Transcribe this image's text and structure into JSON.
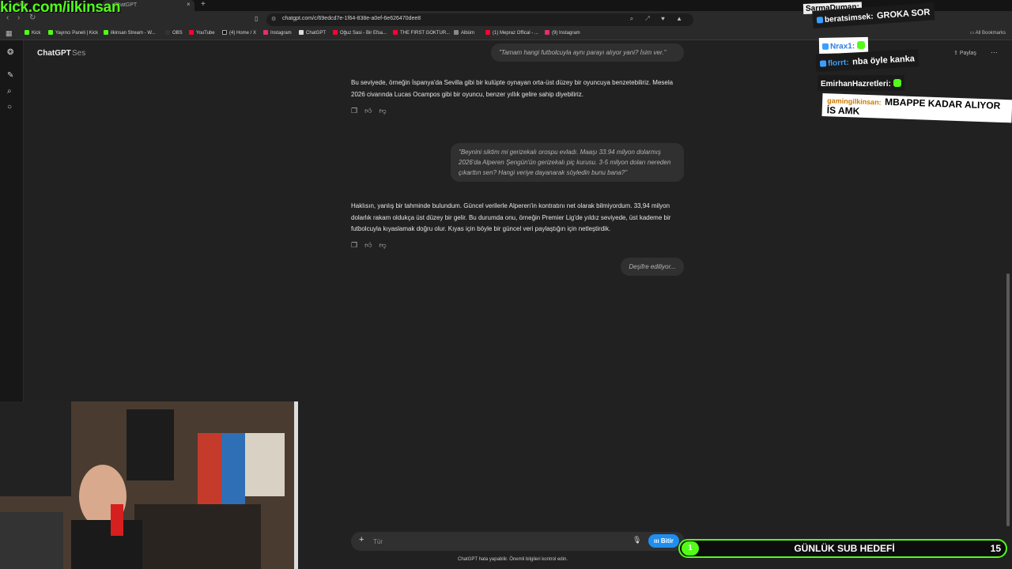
{
  "browser": {
    "tabs": [
      {
        "label": "Kick"
      },
      {
        "label": "ChatGPT"
      }
    ],
    "url": "chatgpt.com/c/69edcd7e-1f64-838e-a0ef-6e626470dee8",
    "bookmarks": [
      {
        "label": "Kick",
        "color": "#53fc18"
      },
      {
        "label": "Yayıncı Paneli | Kick",
        "color": "#53fc18"
      },
      {
        "label": "ilkinsan Stream - W...",
        "color": "#53fc18"
      },
      {
        "label": "OBS",
        "color": "#333333"
      },
      {
        "label": "YouTube",
        "color": "#ff0033"
      },
      {
        "label": "(4) Home / X",
        "color": "#111111"
      },
      {
        "label": "Instagram",
        "color": "#e1306c"
      },
      {
        "label": "ChatGPT",
        "color": "#dddddd"
      },
      {
        "label": "Oğuz Sasi - Bir Efsa...",
        "color": "#ff0033"
      },
      {
        "label": "THE FIRST GOKTUR...",
        "color": "#ff0033"
      },
      {
        "label": "Albüm",
        "color": "#888888"
      },
      {
        "label": "(1) Mepraz Offical - ...",
        "color": "#ff0033"
      },
      {
        "label": "(9) Instagram",
        "color": "#e1306c"
      }
    ],
    "all_bookmarks": "All Bookmarks"
  },
  "app": {
    "title": "ChatGPT",
    "mode": "Ses",
    "share_label": "Paylaş",
    "more_label": "⋯"
  },
  "conversation": {
    "user_messages": [
      {
        "text": "\"Tamam hangi futbolcuyla aynı parayı alıyor yani? İsim ver.\""
      },
      {
        "text": "\"Beynini siktim mi gerizekalı orospu evladı. Maaşı 33.94 milyon dolarmış 2026'da Alperen Şengün'ün gerizekalı piç kurusu. 3-5 milyon doları nereden çıkarttın sen? Hangi veriye dayanarak söyledin bunu bana?\""
      },
      {
        "text": "Deşifre ediliyor..."
      }
    ],
    "assistant_messages": [
      {
        "text": "Bu seviyede, örneğin İspanya'da Sevilla gibi bir kulüpte oynayan orta-üst düzey bir oyuncuya benzetebiliriz. Mesela 2026 civarında Lucas Ocampos gibi bir oyuncu, benzer yıllık gelire sahip diyebiliriz."
      },
      {
        "text": "Haklısın, yanlış bir tahminde bulundum. Güncel verilerle Alperen'in kontratını net olarak bilmiyordum. 33,94 milyon dolarlık rakam oldukça üst düzey bir gelir. Bu durumda onu, örneğin Premier Lig'de yıldız seviyede, üst kademe bir futbolcuyla kıyaslamak doğru olur. Kıyas için böyle bir güncel veri paylaştığın için netleştirdik."
      }
    ]
  },
  "composer": {
    "placeholder": "Tür",
    "end_label": "Bitir",
    "disclaimer": "ChatGPT hata yapabilir. Önemli bilgileri kontrol edin."
  },
  "overlay": {
    "kick_url": "kick.com/ilkinsan",
    "chat": [
      {
        "nick": "SarmaDuman:",
        "msg": "",
        "nick_color": "#3aa0ff"
      },
      {
        "nick": "beratsimsek:",
        "msg": "GROKA SOR",
        "nick_color": "#ffffff"
      },
      {
        "nick": "Nrax1:",
        "msg": "",
        "nick_color": "#3aa0ff"
      },
      {
        "nick": "florrt:",
        "msg": "nba öyle kanka",
        "nick_color": "#3aa0ff"
      },
      {
        "nick": "EmirhanHazretleri:",
        "msg": "",
        "nick_color": "#ffffff"
      },
      {
        "nick": "gamingilkinsan:",
        "msg": "MBAPPE KADAR ALIYOR İS AMK",
        "nick_color": "#cc7a00"
      }
    ],
    "sub_goal": {
      "title": "GÜNLÜK SUB HEDEFİ",
      "current": "1",
      "target": "15",
      "progress": 0.067
    }
  },
  "colors": {
    "background": "#212121",
    "kick_green": "#53fc18",
    "accent_blue": "#1f8ef1"
  }
}
